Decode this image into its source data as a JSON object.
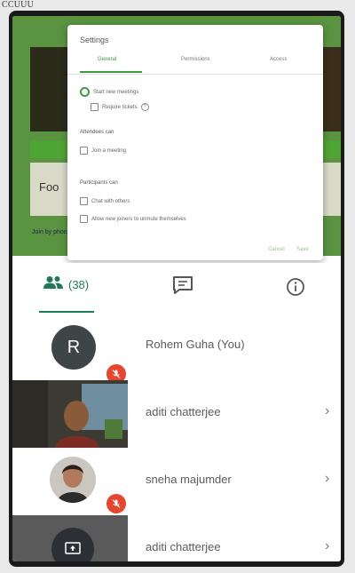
{
  "page_fragment": "CCUUU",
  "dialog": {
    "title": "Settings",
    "tabs": [
      "General",
      "Permissions",
      "Access"
    ],
    "options": {
      "opt1": "Start new meetings",
      "opt1_sub": "Require tickets",
      "section2": "Attendees can",
      "opt2": "Join a meeting",
      "section3": "Participants can",
      "opt3": "Chat with others",
      "opt4": "Allow new joiners to unmute themselves"
    },
    "cancel": "Cancel",
    "save": "Save"
  },
  "stage": {
    "card_text": "Foo",
    "sub_text": "Join by phone"
  },
  "tabs_strip": {
    "people_count": "(38)"
  },
  "participants": [
    {
      "name": "Rohem Guha (You)",
      "avatar_letter": "R"
    },
    {
      "name": "aditi chatterjee"
    },
    {
      "name": "sneha majumder"
    },
    {
      "name": "aditi chatterjee"
    }
  ],
  "colors": {
    "accent": "#1f7a5c",
    "mic_off": "#e8452f",
    "stage": "#5a9440"
  }
}
